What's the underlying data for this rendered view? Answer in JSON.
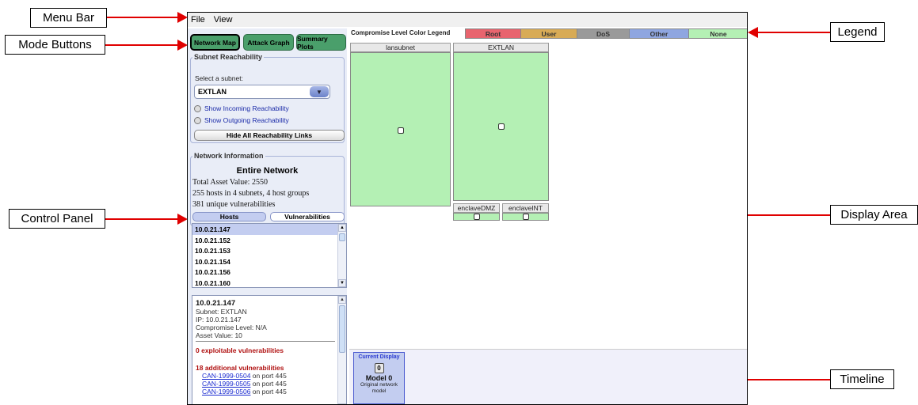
{
  "callouts": {
    "menu_bar": "Menu Bar",
    "mode_buttons": "Mode Buttons",
    "control_panel": "Control Panel",
    "legend": "Legend",
    "display_area": "Display Area",
    "timeline": "Timeline"
  },
  "menu": [
    "File",
    "View"
  ],
  "mode_buttons": [
    "Network Map",
    "Attack Graph",
    "Summary Plots"
  ],
  "reachability": {
    "title": "Subnet Reachability",
    "select_label": "Select a subnet:",
    "selected_subnet": "EXTLAN",
    "incoming": "Show Incoming Reachability",
    "outgoing": "Show Outgoing Reachability",
    "hide_button": "Hide All Reachability Links"
  },
  "network_info": {
    "title": "Network Information",
    "heading": "Entire Network",
    "asset_value": "Total Asset Value: 2550",
    "hosts_summary": "255 hosts in 4 subnets, 4 host groups",
    "vulns_summary": "381 unique vulnerabilities",
    "tab_hosts": "Hosts",
    "tab_vulns": "Vulnerabilities"
  },
  "hosts": [
    "10.0.21.147",
    "10.0.21.152",
    "10.0.21.153",
    "10.0.21.154",
    "10.0.21.156",
    "10.0.21.160"
  ],
  "host_detail": {
    "host": "10.0.21.147",
    "subnet": "Subnet: EXTLAN",
    "ip": "IP: 10.0.21.147",
    "compromise": "Compromise Level: N/A",
    "asset": "Asset Value: 10",
    "exploitable": "0 exploitable vulnerabilities",
    "additional": "18 additional vulnerabilities",
    "vulns": [
      {
        "id": "CAN-1999-0504",
        "port": " on port 445"
      },
      {
        "id": "CAN-1999-0505",
        "port": " on port 445"
      },
      {
        "id": "CAN-1999-0506",
        "port": " on port 445"
      }
    ]
  },
  "legend": {
    "title": "Compromise Level Color Legend",
    "items": [
      {
        "label": "Root",
        "color": "#e8646e"
      },
      {
        "label": "User",
        "color": "#d8ab56"
      },
      {
        "label": "DoS",
        "color": "#9a9a9a"
      },
      {
        "label": "Other",
        "color": "#8fa6e0"
      },
      {
        "label": "None",
        "color": "#b4f0b4"
      }
    ]
  },
  "subnets": [
    "lansubnet",
    "EXTLAN",
    "enclaveDMZ",
    "enclaveINT"
  ],
  "timeline": {
    "label": "Current Display",
    "number": "0",
    "model": "Model 0",
    "desc": "Original network model"
  }
}
